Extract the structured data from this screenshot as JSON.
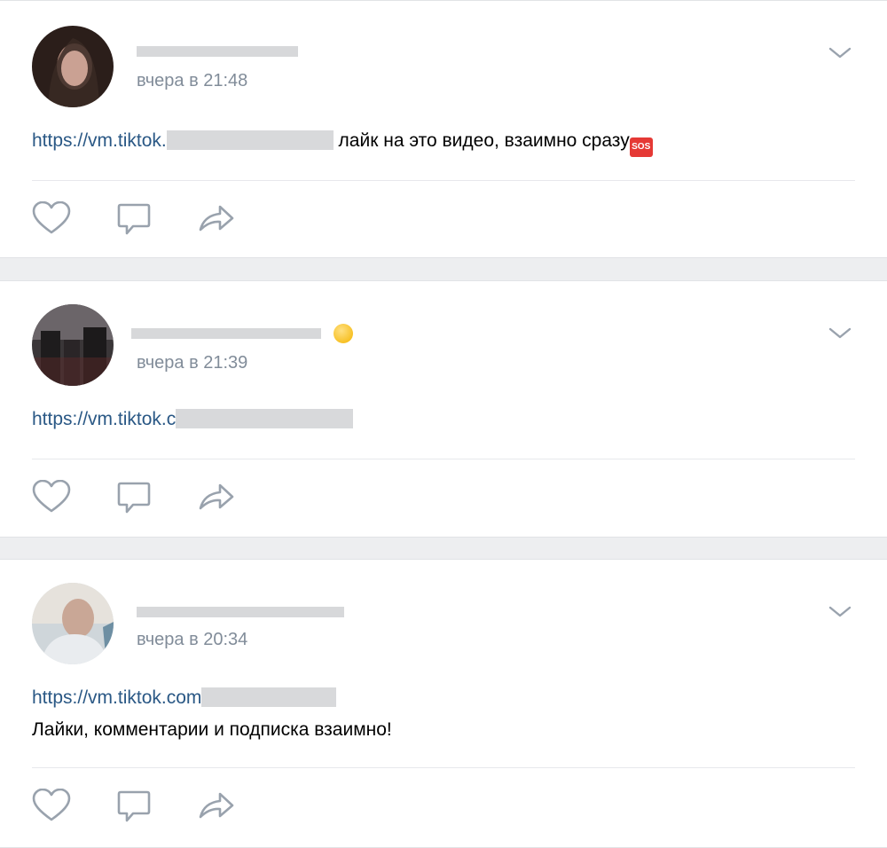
{
  "posts": [
    {
      "time": "вчера в 21:48",
      "link_prefix": "https://vm.tiktok.",
      "text_after_link": " лайк на это видео, взаимно сразу",
      "emoji_badge": "SOS",
      "second_line": ""
    },
    {
      "time": "вчера в 21:39",
      "link_prefix": "https://vm.tiktok.c",
      "text_after_link": "",
      "emoji_badge": "",
      "second_line": ""
    },
    {
      "time": "вчера в 20:34",
      "link_prefix": "https://vm.tiktok.com",
      "text_after_link": "",
      "emoji_badge": "",
      "second_line": "Лайки, комментарии и подписка взаимно!"
    }
  ],
  "icons": {
    "like": "heart-icon",
    "comment": "comment-icon",
    "share": "share-icon",
    "menu": "chevron-down-icon"
  },
  "colors": {
    "background": "#edeef0",
    "card": "#ffffff",
    "author": "#2a5885",
    "meta": "#818c99",
    "icon": "#99a2ad"
  }
}
